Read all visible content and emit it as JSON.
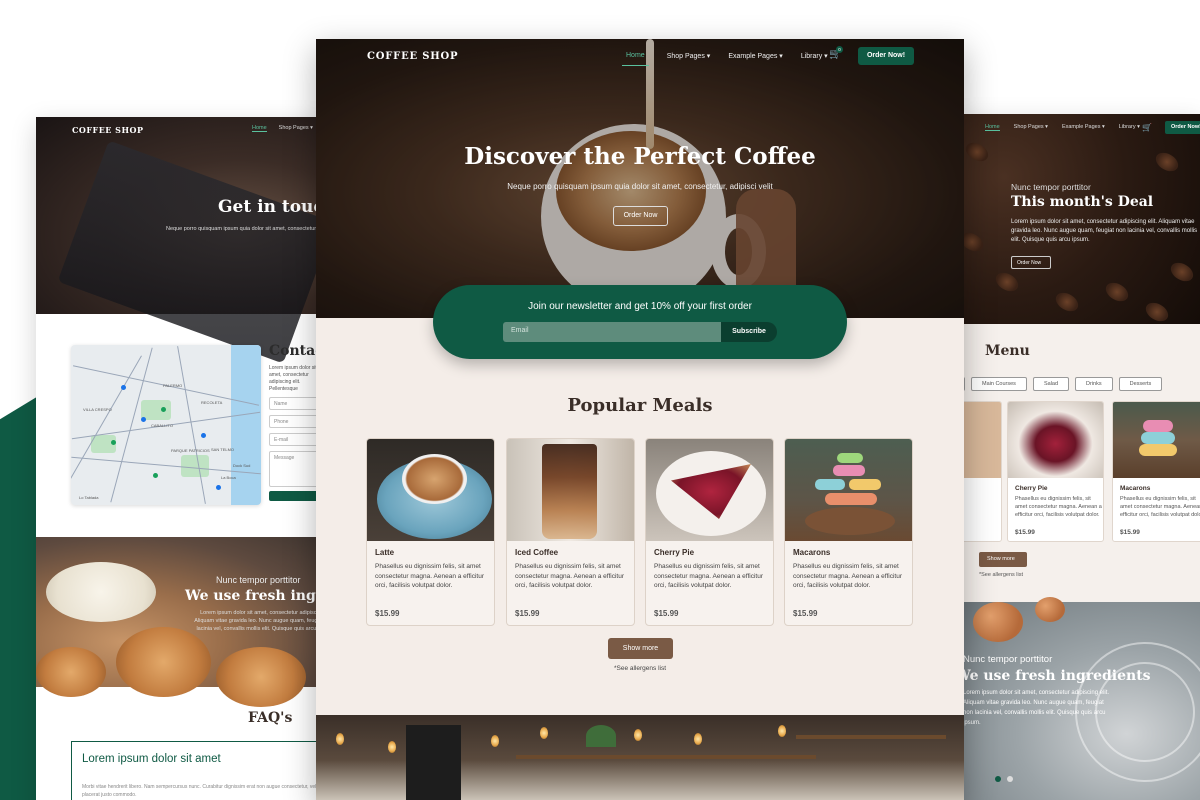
{
  "brand": "COFFEE SHOP",
  "nav": {
    "home": "Home",
    "shop_pages": "Shop Pages",
    "example_pages": "Example Pages",
    "library": "Library",
    "cart_count": "0",
    "order_now": "Order Now!"
  },
  "hero": {
    "title": "Discover the Perfect Coffee",
    "subtitle": "Neque porro quisquam ipsum quia dolor sit amet, consectetur, adipisci velit",
    "button": "Order Now"
  },
  "newsletter": {
    "text": "Join our newsletter and get 10% off your first order",
    "placeholder": "Email",
    "button": "Subscribe"
  },
  "popular": {
    "title": "Popular Meals",
    "items": [
      {
        "name": "Latte",
        "desc": "Phasellus eu dignissim felis, sit amet consectetur magna. Aenean a efficitur orci, facilisis volutpat dolor.",
        "price": "$15.99"
      },
      {
        "name": "Iced Coffee",
        "desc": "Phasellus eu dignissim felis, sit amet consectetur magna. Aenean a efficitur orci, facilisis volutpat dolor.",
        "price": "$15.99"
      },
      {
        "name": "Cherry Pie",
        "desc": "Phasellus eu dignissim felis, sit amet consectetur magna. Aenean a efficitur orci, facilisis volutpat dolor.",
        "price": "$15.99"
      },
      {
        "name": "Macarons",
        "desc": "Phasellus eu dignissim felis, sit amet consectetur magna. Aenean a efficitur orci, facilisis volutpat dolor.",
        "price": "$15.99"
      }
    ],
    "show_more": "Show more",
    "allergens": "*See allergens list"
  },
  "left_page": {
    "title": "Get in touch",
    "subtitle": "Neque porro quisquam ipsum quia dolor sit amet, consectetur",
    "contact_title": "Contact",
    "contact_text": "Lorem ipsum dolor sit amet, consectetur adipiscing elit. Pellentesque",
    "fields": [
      "Name",
      "Phone",
      "E-mail",
      "Message"
    ],
    "map_labels": [
      "PALERMO",
      "VILLA CRESPO",
      "CABALLITO",
      "RECOLETA",
      "SAN TELMO",
      "PARQUE PATRICIOS",
      "Dock Sud",
      "La Boca",
      "Lo Tablada"
    ],
    "fresh_kicker": "Nunc tempor porttitor",
    "fresh_title": "We use fresh ingredients",
    "fresh_text": "Lorem ipsum dolor sit amet, consectetur adipiscing elit. Aliquam vitae gravida leo. Nunc augue quam, feugiat non lacinia vel, convallis mollis elit. Quisque quis arcu ipsum.",
    "faq_title": "FAQ's",
    "faq_q": "Lorem ipsum dolor sit amet",
    "faq_a": "Morbi vitae hendrerit libero. Nam sempercursus nunc. Curabitur dignissim erat non augue consectetur, vel placerat justo commodo."
  },
  "right_page": {
    "kicker": "Nunc tempor porttitor",
    "title": "This month's Deal",
    "text": "Lorem ipsum dolor sit amet, consectetur adipiscing elit. Aliquam vitae gravida leo. Nunc augue quam, feugiat non lacinia vel, convallis mollis elit. Quisque quis arcu ipsum.",
    "button": "Order Now",
    "menu_title": "Menu",
    "tabs": [
      "Main Courses",
      "Salad",
      "Drinks",
      "Desserts"
    ],
    "items": [
      {
        "name": "Cherry Pie",
        "desc": "Phasellus eu dignissim felis, sit amet consectetur magna. Aenean a efficitur orci, facilisis volutpat dolor.",
        "price": "$15.99"
      },
      {
        "name": "Macarons",
        "desc": "Phasellus eu dignissim felis, sit amet consectetur magna. Aenean a efficitur orci, facilisis volutpat dolor.",
        "price": "$15.99"
      }
    ],
    "show_more": "Show more",
    "allergens": "*See allergens list",
    "fresh_kicker": "Nunc tempor porttitor",
    "fresh_title": "We use fresh ingredients",
    "fresh_text": "Lorem ipsum dolor sit amet, consectetur adipiscing elit. Aliquam vitae gravida leo. Nunc augue quam, feugiat non lacinia vel, convallis mollis elit. Quisque quis arcu ipsum."
  },
  "colors": {
    "brand_green": "#0f5a44",
    "brown_button": "#7a5a45",
    "cream": "#f4ede8",
    "nav_active": "#5ac19e"
  }
}
